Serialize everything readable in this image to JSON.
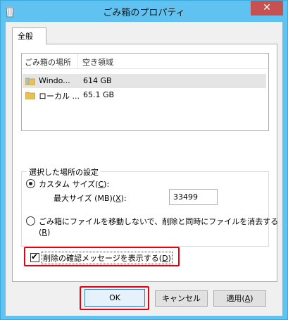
{
  "window": {
    "title": "ごみ箱のプロパティ",
    "close_glyph": "✕"
  },
  "tabs": [
    {
      "label": "全般"
    }
  ],
  "locations": {
    "columns": [
      "ごみ箱の場所",
      "空き領域"
    ],
    "rows": [
      {
        "name": "Windo...",
        "free": "614 GB",
        "selected": true
      },
      {
        "name": "ローカル ...",
        "free": "65.1 GB",
        "selected": false
      }
    ]
  },
  "settings": {
    "legend": "選択した場所の設定",
    "custom_size": {
      "label": "カスタム サイズ(",
      "accel": "C",
      "label_end": "):",
      "selected": true
    },
    "max_size": {
      "label": "最大サイズ (MB)(",
      "accel": "X",
      "label_end": "):",
      "value": "33499"
    },
    "no_move": {
      "label": "ごみ箱にファイルを移動しないで、削除と同時にファイルを消去する",
      "accel_prefix": "(",
      "accel": "R",
      "accel_suffix": ")",
      "selected": false
    }
  },
  "confirm": {
    "label": "削除の確認メッセージを表示する(",
    "accel": "D",
    "label_end": ")",
    "checked": true
  },
  "buttons": {
    "ok": "OK",
    "cancel": "キャンセル",
    "apply_label": "適用(",
    "apply_accel": "A",
    "apply_end": ")"
  },
  "colors": {
    "highlight": "#e60012",
    "title_bar": "#5fc2f1",
    "close": "#c75050"
  }
}
